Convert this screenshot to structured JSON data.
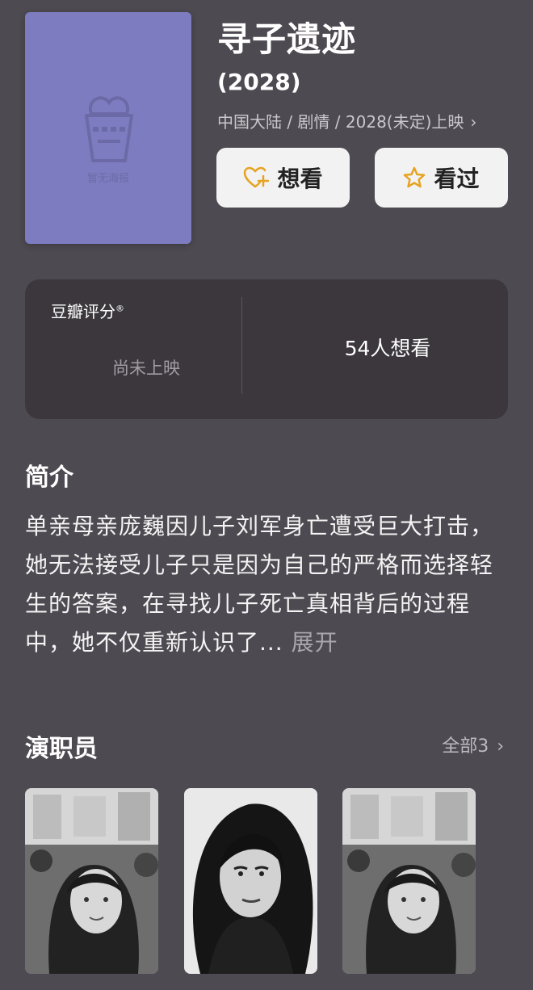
{
  "poster": {
    "caption": "暂无海报",
    "color": "#7d7cc0"
  },
  "movie": {
    "title": "寻子遗迹",
    "year": "(2028)",
    "meta": "中国大陆 / 剧情 / 2028(未定)上映"
  },
  "actions": {
    "want_label": "想看",
    "seen_label": "看过",
    "icon_color": "#e6a321"
  },
  "rating": {
    "label": "豆瓣评分",
    "mark": "®",
    "status": "尚未上映",
    "want_count": "54人想看"
  },
  "intro": {
    "title": "简介",
    "text": "单亲母亲庞巍因儿子刘军身亡遭受巨大打击，她无法接受儿子只是因为自己的严格而选择轻生的答案，在寻找儿子死亡真相背后的过程中，她不仅重新认识了...",
    "more": "展开"
  },
  "cast": {
    "title": "演职员",
    "all_label": "全部3",
    "members": [
      {
        "photo": "woman-photo-1"
      },
      {
        "photo": "woman-photo-2"
      },
      {
        "photo": "woman-photo-1"
      }
    ]
  }
}
